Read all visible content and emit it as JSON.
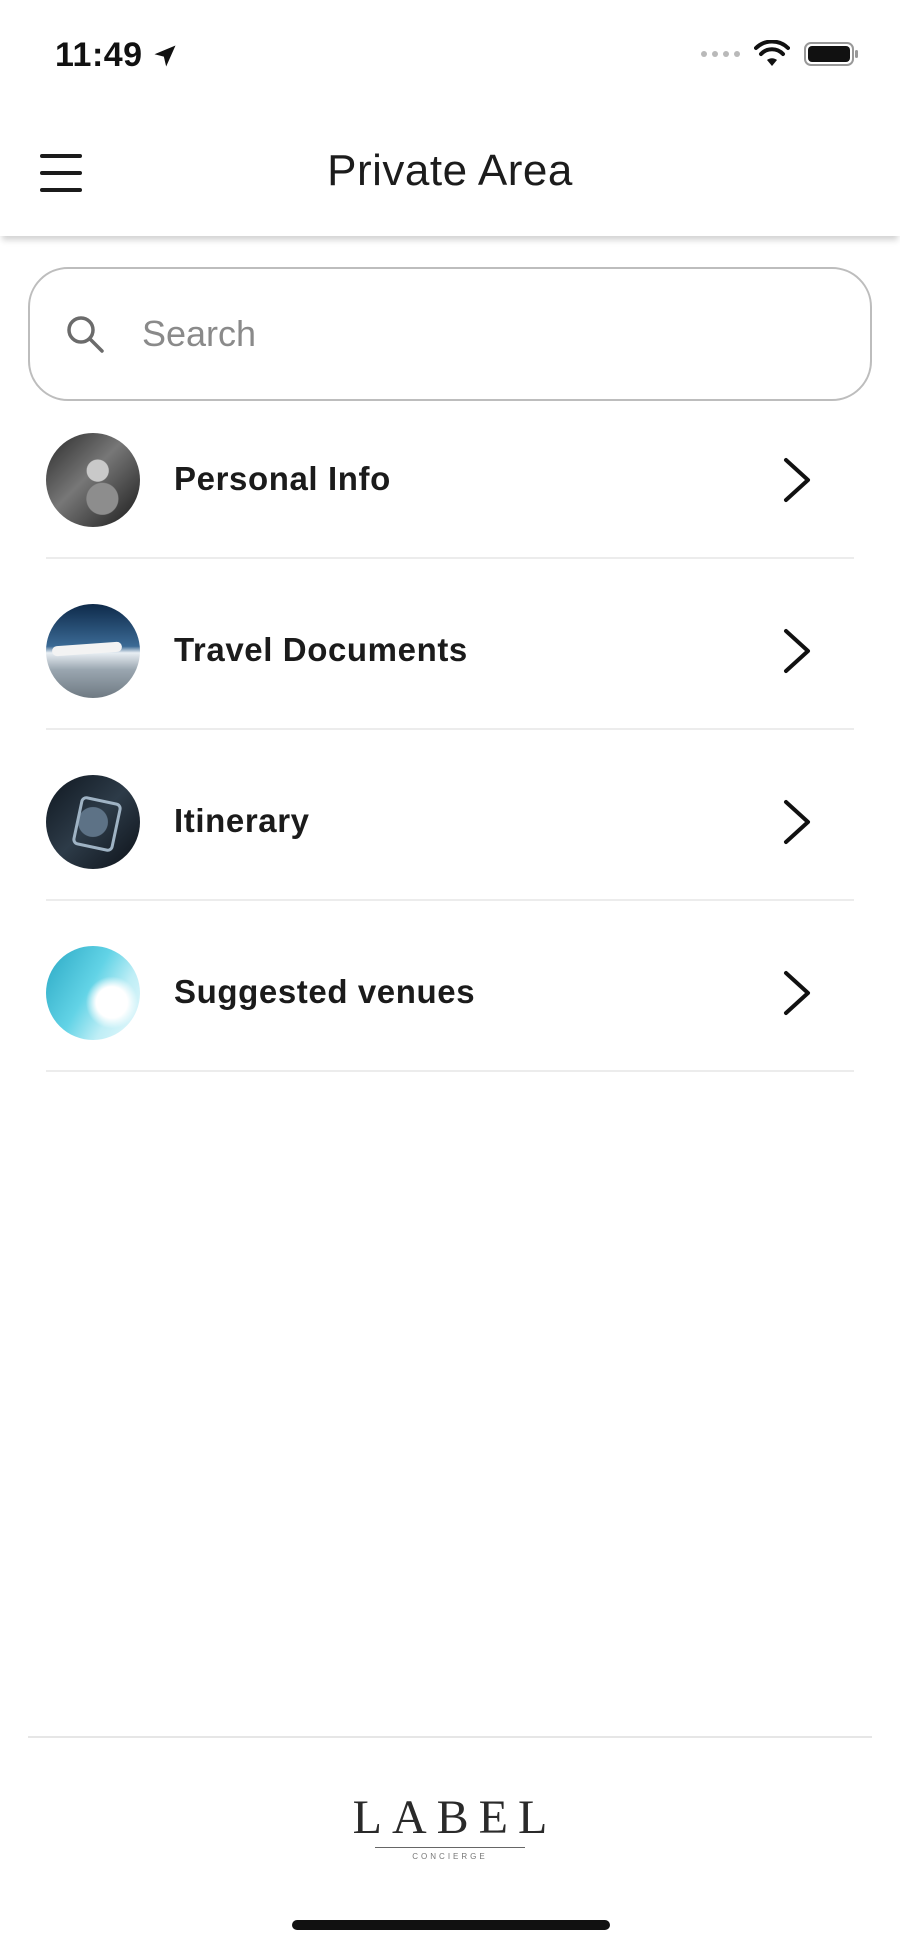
{
  "status_bar": {
    "time": "11:49"
  },
  "header": {
    "title": "Private Area"
  },
  "search": {
    "placeholder": "Search",
    "value": ""
  },
  "menu": {
    "items": [
      {
        "label": "Personal Info"
      },
      {
        "label": "Travel Documents"
      },
      {
        "label": "Itinerary"
      },
      {
        "label": "Suggested venues"
      }
    ]
  },
  "footer": {
    "brand": "LABEL",
    "brand_sub": "CONCIERGE"
  }
}
